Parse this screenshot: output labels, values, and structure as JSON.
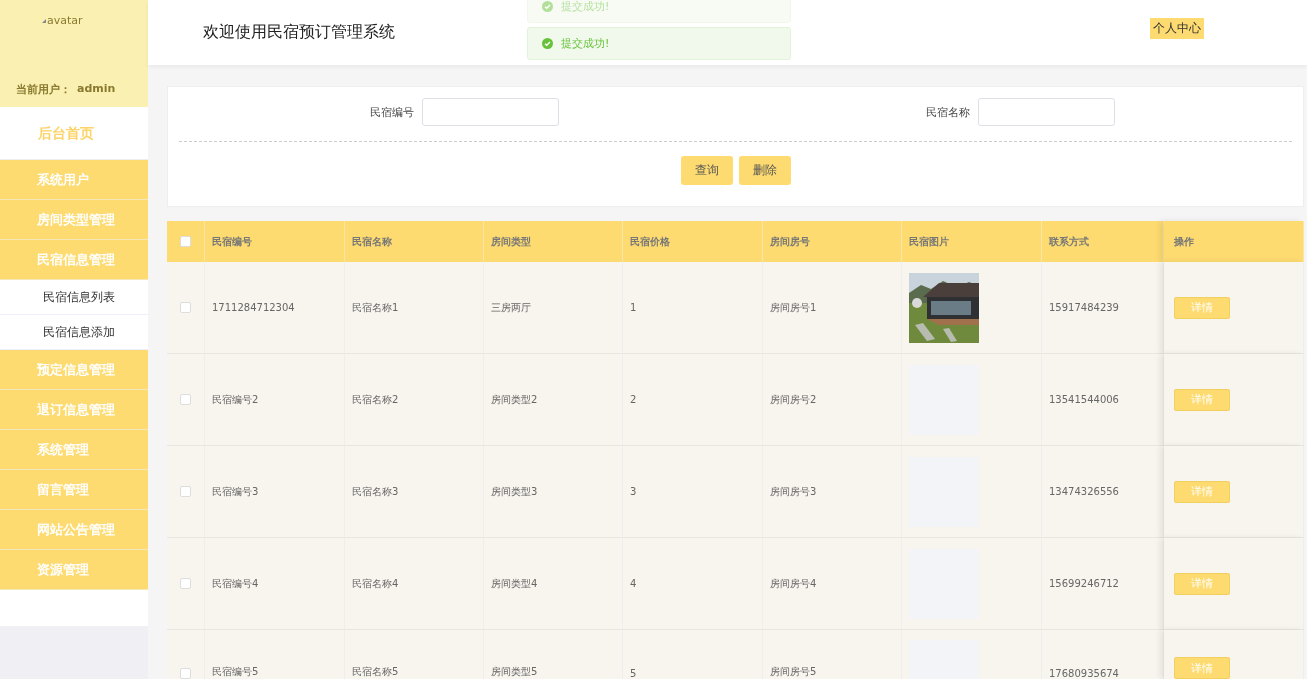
{
  "sidebar": {
    "avatar_alt": "avatar",
    "user_label": "当前用户：",
    "user_name": "admin",
    "items": [
      {
        "label": "后台首页",
        "kind": "home"
      },
      {
        "label": "系统用户",
        "kind": "menu"
      },
      {
        "label": "房间类型管理",
        "kind": "menu"
      },
      {
        "label": "民宿信息管理",
        "kind": "menu",
        "expanded": true,
        "children": [
          {
            "label": "民宿信息列表"
          },
          {
            "label": "民宿信息添加"
          }
        ]
      },
      {
        "label": "预定信息管理",
        "kind": "menu"
      },
      {
        "label": "退订信息管理",
        "kind": "menu"
      },
      {
        "label": "系统管理",
        "kind": "menu"
      },
      {
        "label": "留言管理",
        "kind": "menu"
      },
      {
        "label": "网站公告管理",
        "kind": "menu"
      },
      {
        "label": "资源管理",
        "kind": "menu"
      }
    ]
  },
  "header": {
    "title": "欢迎使用民宿预订管理系统",
    "profile_link": "个人中心"
  },
  "toasts": [
    {
      "text": "提交成功!",
      "faded": true
    },
    {
      "text": "提交成功!",
      "faded": false
    }
  ],
  "search": {
    "fields": [
      {
        "label": "民宿编号"
      },
      {
        "label": "民宿名称"
      }
    ],
    "buttons": [
      "查询",
      "删除"
    ]
  },
  "table": {
    "select_all": {
      "checked": false
    },
    "columns": [
      "民宿编号",
      "民宿名称",
      "房间类型",
      "民宿价格",
      "房间房号",
      "民宿图片",
      "联系方式",
      "操作"
    ],
    "rows": [
      {
        "checked": false,
        "cells": [
          "1711284712304",
          "民宿名称1",
          "三房两厅",
          "1",
          "房间房号1"
        ],
        "phone": "15917484239",
        "action": "详情"
      },
      {
        "checked": false,
        "cells": [
          "民宿编号2",
          "民宿名称2",
          "房间类型2",
          "2",
          "房间房号2"
        ],
        "image": {
          "kind": "placeholder"
        },
        "phone": "13541544006",
        "action": "详情"
      },
      {
        "checked": false,
        "cells": [
          "民宿编号3",
          "民宿名称3",
          "房间类型3",
          "3",
          "房间房号3"
        ],
        "image": {
          "kind": "placeholder"
        },
        "phone": "13474326556",
        "action": "详情"
      },
      {
        "checked": false,
        "cells": [
          "民宿编号4",
          "民宿名称4",
          "房间类型4",
          "4",
          "房间房号4"
        ],
        "image": {
          "kind": "placeholder"
        },
        "phone": "15699246712",
        "action": "详情"
      },
      {
        "checked": false,
        "cells": [
          "民宿编号5",
          "民宿名称5",
          "房间类型5",
          "5",
          "房间房号5"
        ],
        "image": {
          "kind": "placeholder"
        },
        "phone": "17680935674",
        "action": "详情"
      }
    ]
  }
}
